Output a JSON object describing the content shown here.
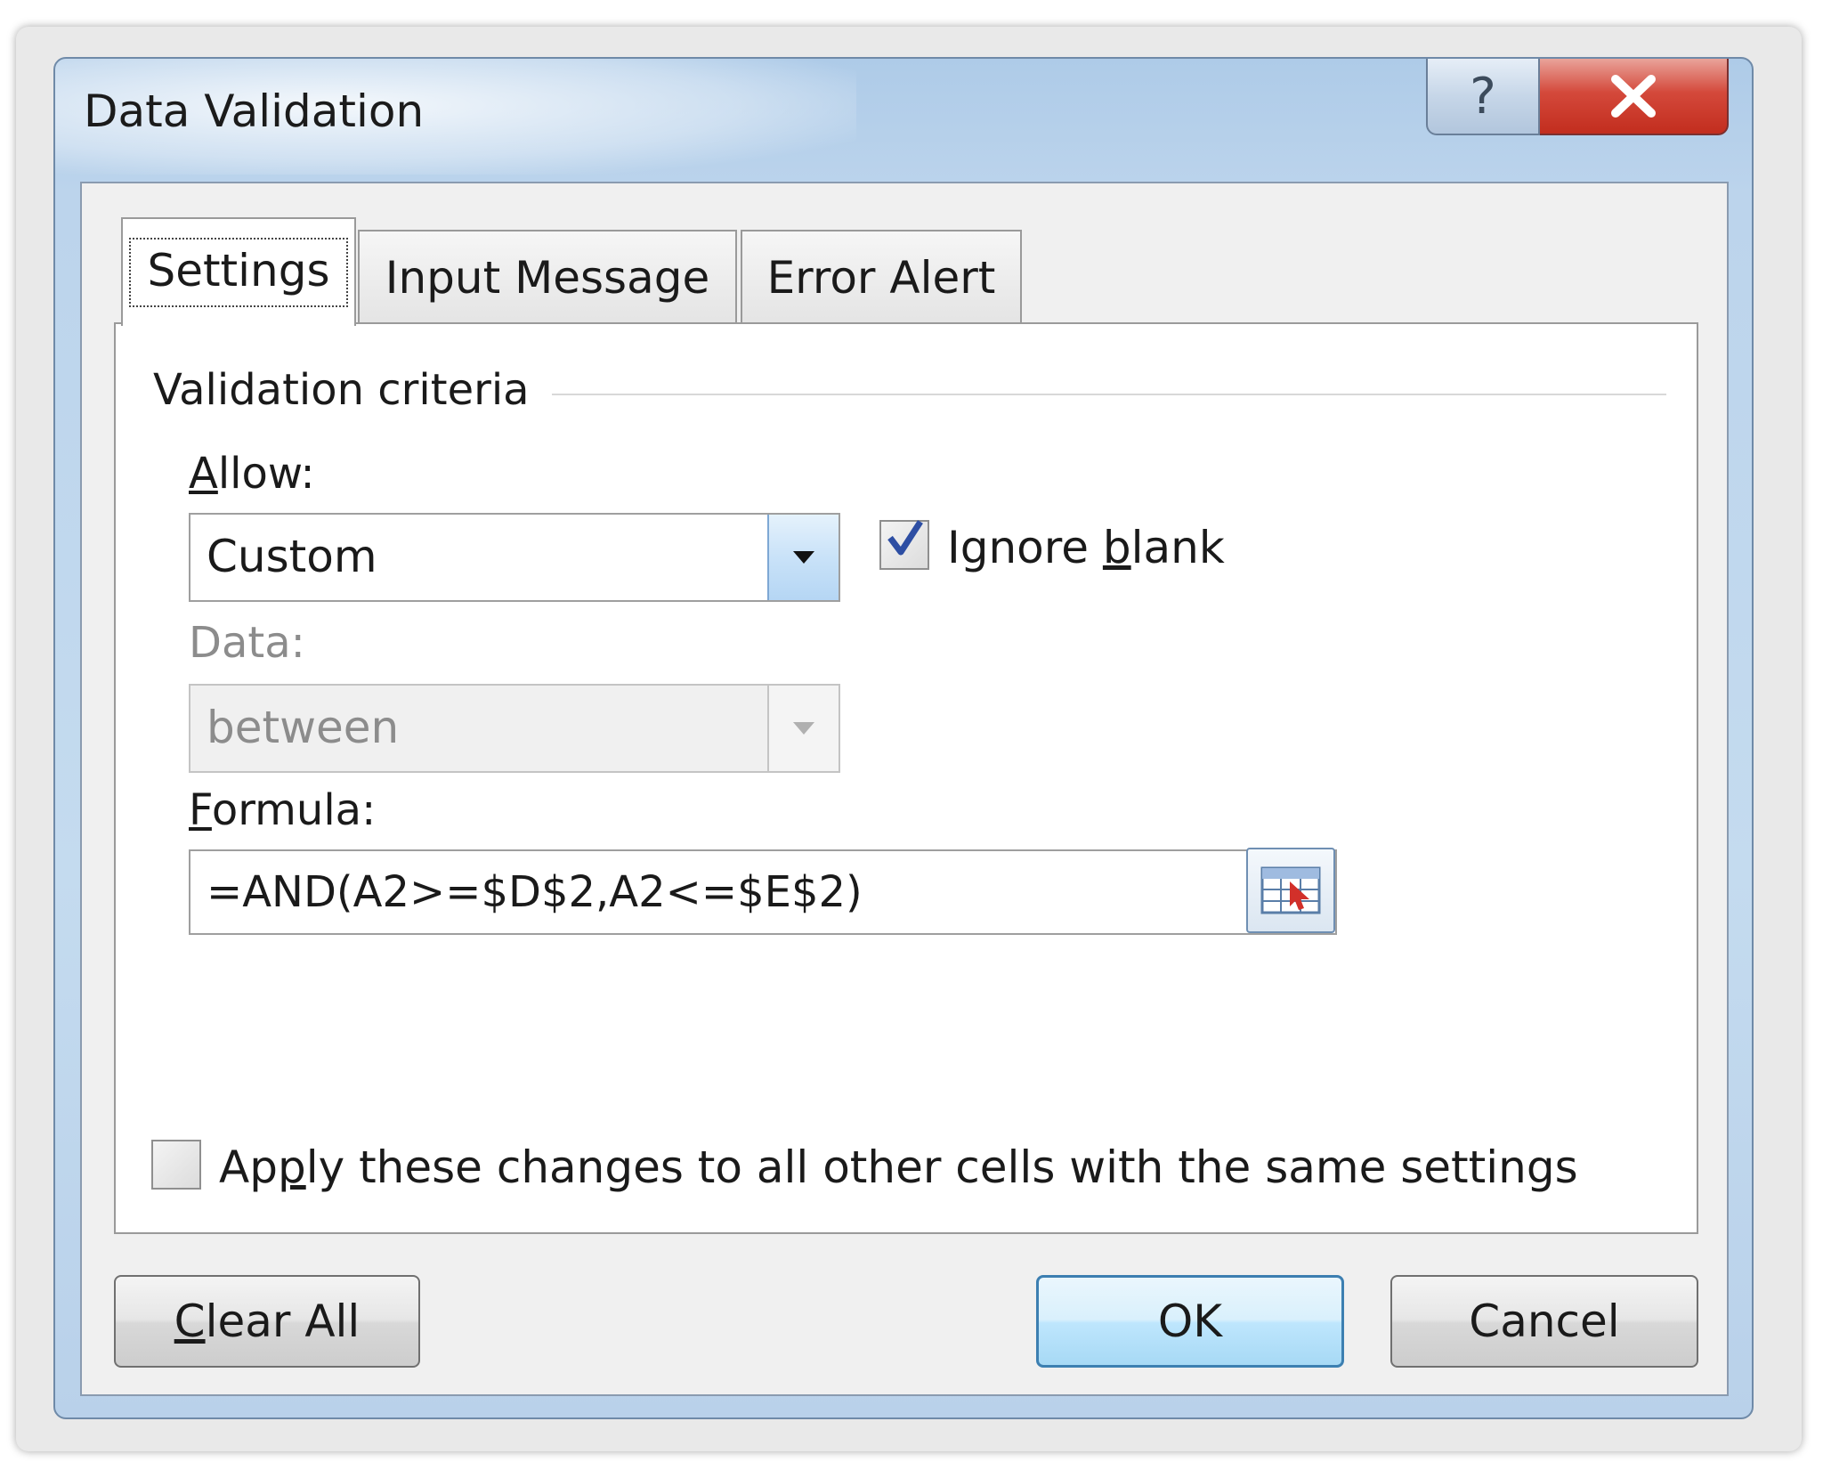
{
  "window": {
    "title": "Data Validation",
    "help_glyph": "?",
    "close_glyph": "X"
  },
  "tabs": [
    {
      "label": "Settings",
      "active": true
    },
    {
      "label": "Input Message",
      "active": false
    },
    {
      "label": "Error Alert",
      "active": false
    }
  ],
  "settings": {
    "group_label": "Validation criteria",
    "allow": {
      "label_accel": "A",
      "label_rest": "llow:",
      "value": "Custom"
    },
    "ignore_blank": {
      "checked": true,
      "label_pre": "Ignore ",
      "label_accel": "b",
      "label_post": "lank"
    },
    "data": {
      "label": "Data:",
      "value": "between",
      "disabled": true
    },
    "formula": {
      "label_accel": "F",
      "label_rest": "ormula:",
      "value": "=AND(A2>=$D$2,A2<=$E$2)"
    },
    "apply_all": {
      "checked": false,
      "label_pre": "Ap",
      "label_accel": "p",
      "label_post": "ly these changes to all other cells with the same settings"
    }
  },
  "buttons": {
    "clear_accel": "C",
    "clear_rest": "lear All",
    "ok": "OK",
    "cancel": "Cancel"
  },
  "colors": {
    "accent_blue": "#3c7fb1",
    "close_red": "#c22d1e",
    "frame_blue": "#bcd4ec"
  }
}
